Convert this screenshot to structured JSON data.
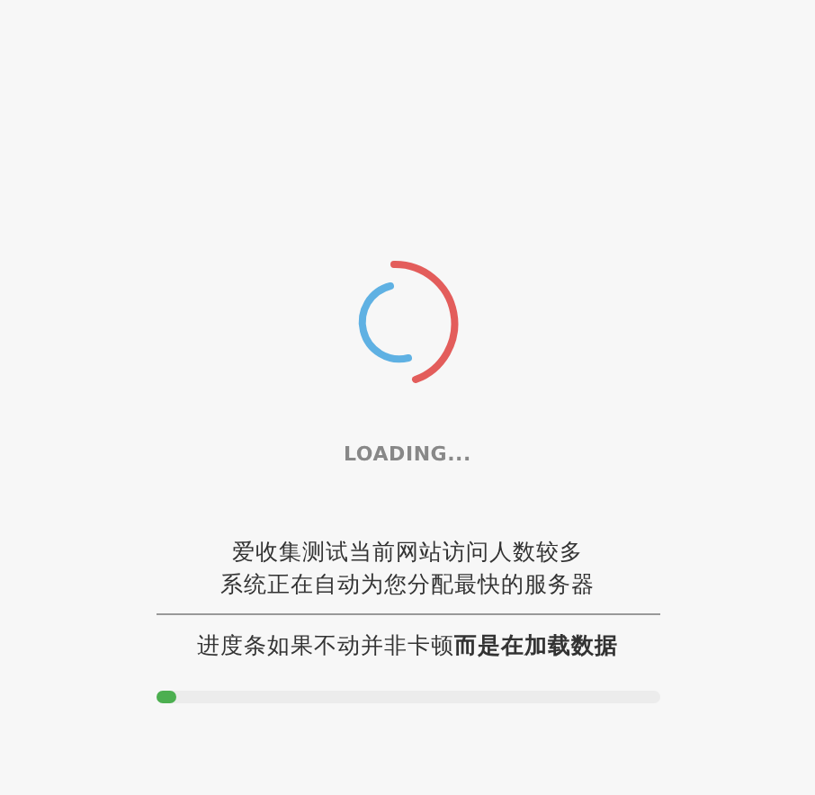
{
  "loading_label": "LOADING...",
  "notice": [
    "爱收集测试当前网站访问人数较多",
    "系统正在自动为您分配最快的服务器"
  ],
  "hint": "进度条如果不动并非卡顿**而是在加载数据**",
  "progress": {
    "level": 0.04
  }
}
